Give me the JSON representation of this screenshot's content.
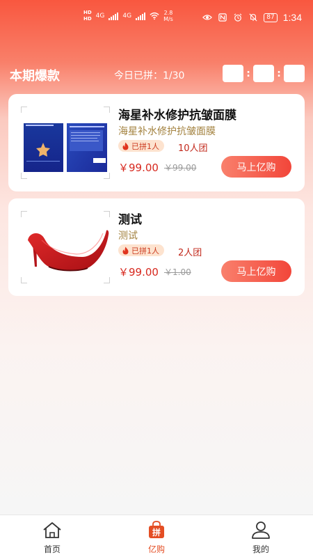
{
  "status_bar": {
    "hd_top": "HD",
    "hd_bottom": "HD",
    "net1": "4G",
    "net2": "4G",
    "speed_value": "2.8",
    "speed_unit": "M/s",
    "battery": "87",
    "time": "1:34",
    "icons": [
      "eye-icon",
      "nfc-icon",
      "alarm-icon",
      "mute-icon",
      "battery-icon"
    ]
  },
  "header": {
    "title": "本期爆款",
    "count_text": "今日已拼：1/30",
    "timer_separator": ":"
  },
  "products": [
    {
      "name": "海星补水修护抗皱面膜",
      "subtitle": "海星补水修护抗皱面膜",
      "badge": "已拼1人",
      "group": "10人团",
      "price": "￥99.00",
      "original_price": "￥99.00",
      "buy_label": "马上亿购",
      "image": "face-mask-package"
    },
    {
      "name": "测试",
      "subtitle": "测试",
      "badge": "已拼1人",
      "group": "2人团",
      "price": "￥99.00",
      "original_price": "￥1.00",
      "buy_label": "马上亿购",
      "image": "red-high-heel-shoe"
    }
  ],
  "tabbar": {
    "tabs": [
      {
        "label": "首页",
        "icon": "home-icon",
        "active": false
      },
      {
        "label": "亿购",
        "icon": "shopping-bag-icon",
        "active": true,
        "icon_text": "拼"
      },
      {
        "label": "我的",
        "icon": "user-icon",
        "active": false
      }
    ],
    "active_color": "#e44e24"
  },
  "colors": {
    "accent": "#f9573f",
    "price": "#d7281e",
    "subtitle": "#a3823f"
  }
}
